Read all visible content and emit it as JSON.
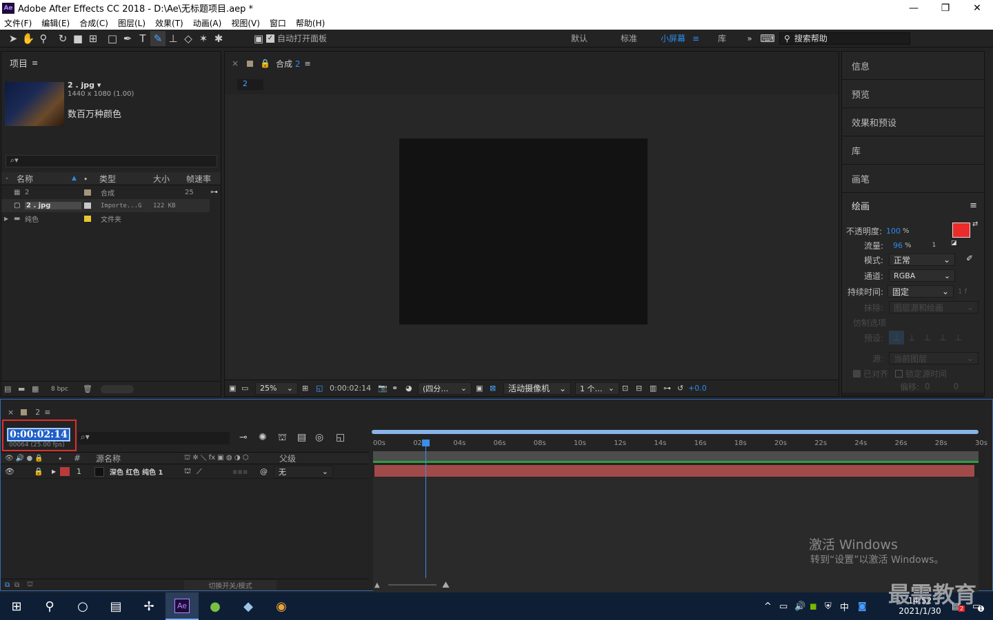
{
  "window": {
    "title": "Adobe After Effects CC 2018 - D:\\Ae\\无标题项目.aep *",
    "logo": "Ae",
    "min": "—",
    "max": "❐",
    "close": "✕"
  },
  "menu": [
    "文件(F)",
    "编辑(E)",
    "合成(C)",
    "图层(L)",
    "效果(T)",
    "动画(A)",
    "视图(V)",
    "窗口",
    "帮助(H)"
  ],
  "toolbar": {
    "auto_open": "自动打开面板",
    "workspaces": [
      "默认",
      "标准",
      "小屏幕",
      "库"
    ],
    "active_workspace": "小屏幕",
    "more": "»",
    "search_placeholder": "搜索帮助"
  },
  "project": {
    "title": "项目",
    "asset_name": "2 . jpg",
    "asset_dims": "1440 x 1080 (1.00)",
    "asset_color": "数百万种颜色",
    "search_icon": "⌕▾",
    "columns": [
      "名称",
      "类型",
      "大小",
      "帧速率"
    ],
    "rows": [
      {
        "name": "2",
        "type": "合成",
        "size": "",
        "fps": "25",
        "color": "#a5957a"
      },
      {
        "name": "2 . jpg",
        "type": "Importe...G",
        "size": "122 KB",
        "fps": "",
        "color": "#c8c8c8"
      },
      {
        "name": "纯色",
        "type": "文件夹",
        "size": "",
        "fps": "",
        "color": "#e8c72e"
      }
    ],
    "bpc": "8 bpc"
  },
  "comp": {
    "close": "×",
    "title": "合成",
    "name": "2",
    "tab": "2",
    "zoom": "25%",
    "time": "0:00:02:14",
    "quality": "(四分…",
    "camera": "活动摄像机",
    "views": "1 个…",
    "exposure": "+0.0"
  },
  "right_panels": [
    "信息",
    "预览",
    "效果和预设",
    "库",
    "画笔"
  ],
  "paint": {
    "title": "绘画",
    "opacity_label": "不透明度:",
    "opacity": "100",
    "opacity_unit": "%",
    "flow_label": "流量:",
    "flow": "96",
    "flow_unit": "%",
    "one": "1",
    "mode_label": "模式:",
    "mode": "正常",
    "channel_label": "通道:",
    "channel": "RGBA",
    "duration_label": "持续时间:",
    "duration": "固定",
    "duration_suffix": "1 f",
    "erase_label": "抹除:",
    "erase": "图层源和绘画",
    "clone_label": "仿制选项",
    "preset_label": "预设:",
    "source_label": "源:",
    "source": "当前图层",
    "aligned": "已对齐",
    "lock_time": "锁定源时间",
    "offset_label": "偏移:",
    "offset_x": "0",
    "offset_y": "0",
    "fg_color": "#ee2b2b",
    "bg_color": "#ee1a1a"
  },
  "timeline": {
    "close": "×",
    "name": "2",
    "timecode": "0:00:02:14",
    "frames": "00064 (25.00 fps)",
    "col_source": "源名称",
    "col_num": "#",
    "col_parent": "父级",
    "layer": {
      "num": "1",
      "name": "深色 红色 纯色 1",
      "parent": "无",
      "color": "#b83b3b"
    },
    "ticks": [
      "00s",
      "02s",
      "04s",
      "06s",
      "08s",
      "10s",
      "12s",
      "14s",
      "16s",
      "18s",
      "20s",
      "22s",
      "24s",
      "26s",
      "28s",
      "30s"
    ],
    "footer": "切换开关/模式"
  },
  "watermark": {
    "line1": "激活 Windows",
    "line2": "转到“设置”以激活 Windows。",
    "brand": "最需教育"
  },
  "taskbar": {
    "time": "14:52",
    "date": "2021/1/30",
    "ime": "中",
    "badge": "2",
    "notif": "1"
  }
}
